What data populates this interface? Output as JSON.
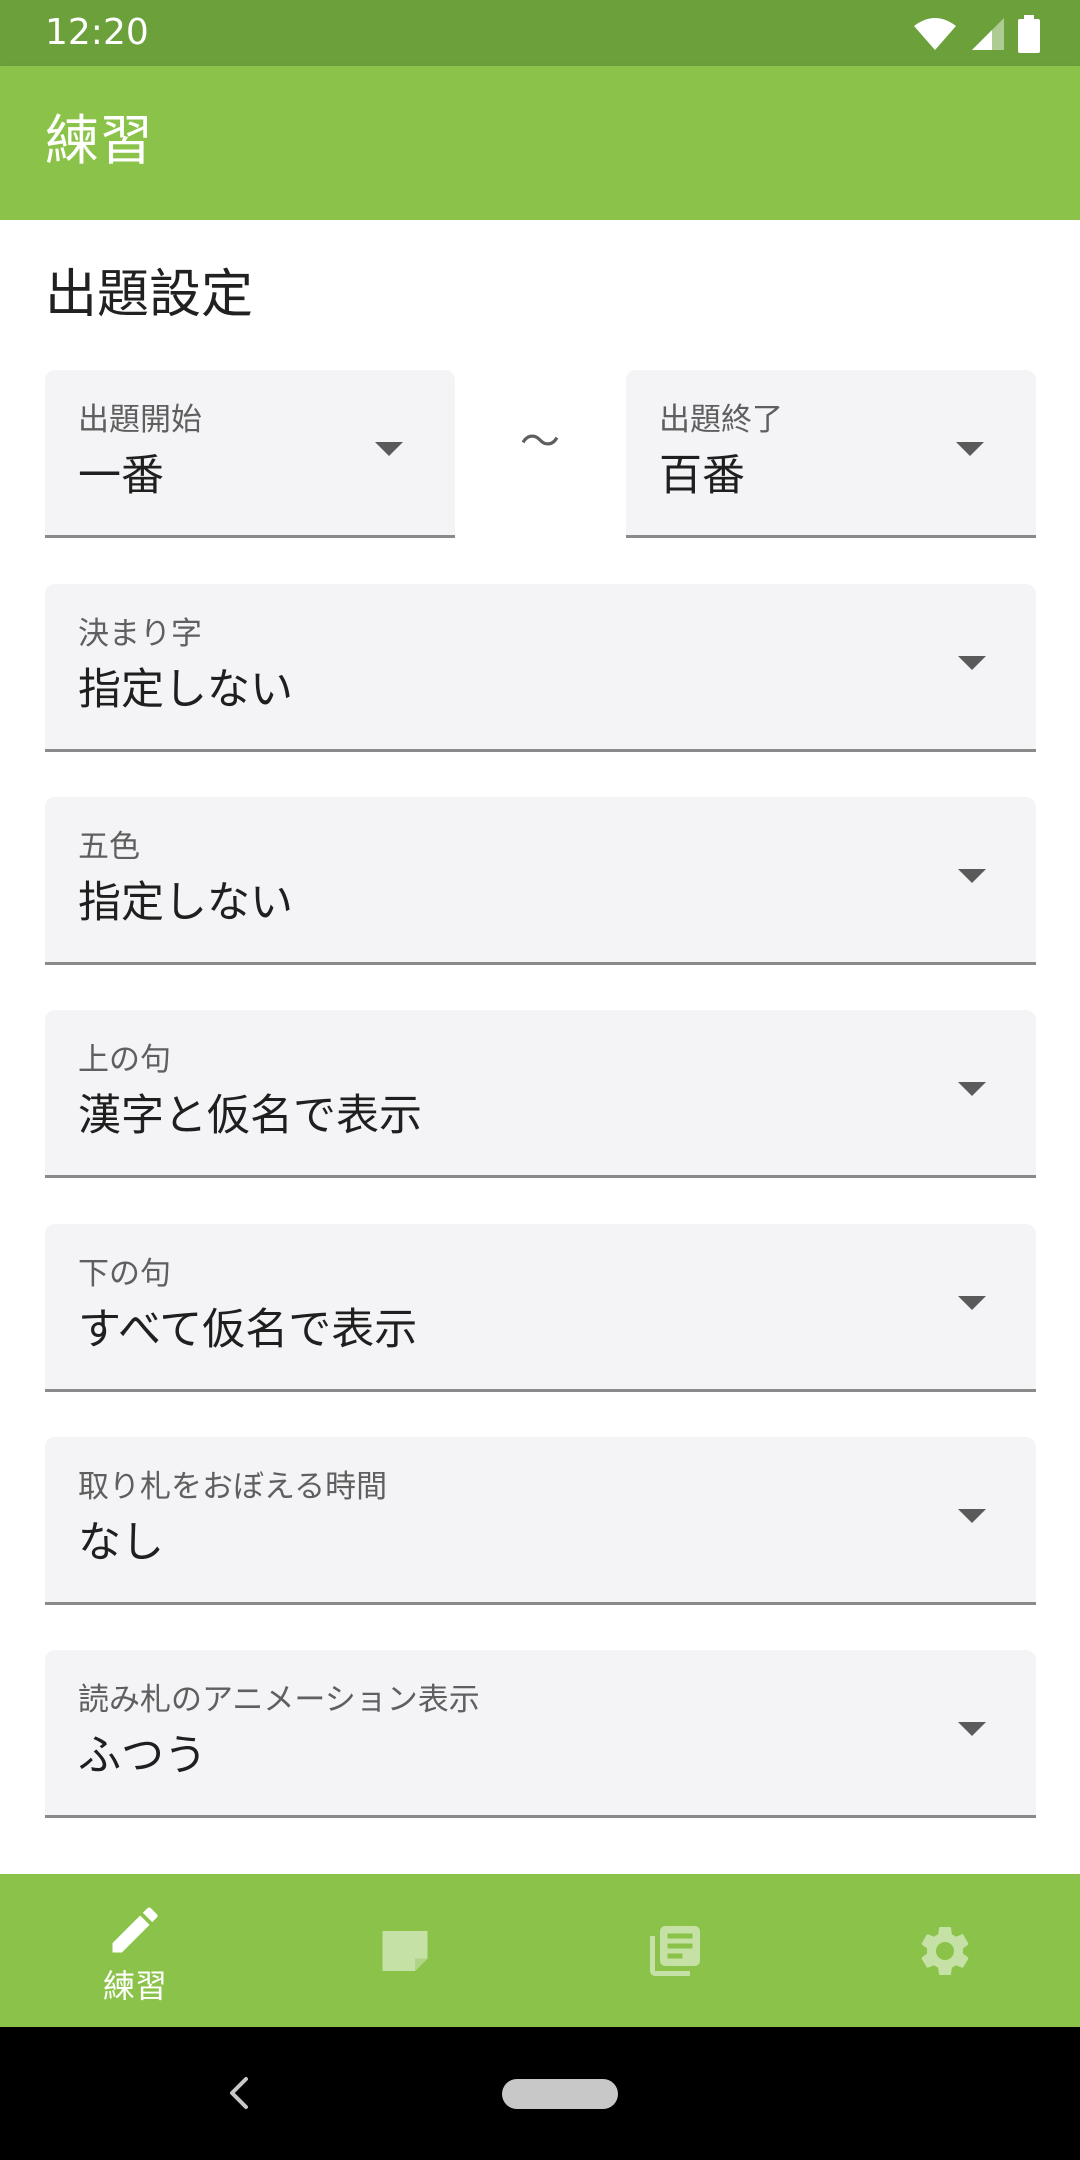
{
  "status_bar": {
    "time": "12:20"
  },
  "app_bar": {
    "title": "練習"
  },
  "section": {
    "title": "出題設定"
  },
  "range": {
    "start": {
      "label": "出題開始",
      "value": "一番"
    },
    "separator": "〜",
    "end": {
      "label": "出題終了",
      "value": "百番"
    }
  },
  "fields": [
    {
      "label": "決まり字",
      "value": "指定しない"
    },
    {
      "label": "五色",
      "value": "指定しない"
    },
    {
      "label": "上の句",
      "value": "漢字と仮名で表示"
    },
    {
      "label": "下の句",
      "value": "すべて仮名で表示"
    },
    {
      "label": "取り札をおぼえる時間",
      "value": "なし"
    },
    {
      "label": "読み札のアニメーション表示",
      "value": "ふつう"
    }
  ],
  "bottom_nav": {
    "items": [
      {
        "label": "練習",
        "icon": "pencil-icon",
        "active": true
      },
      {
        "label": "",
        "icon": "card-icon",
        "active": false
      },
      {
        "label": "",
        "icon": "library-icon",
        "active": false
      },
      {
        "label": "",
        "icon": "gear-icon",
        "active": false
      }
    ]
  },
  "colors": {
    "status_bar": "#6ba03b",
    "primary": "#8bc34a",
    "field_background": "#f4f3f6",
    "inactive_icon": "#c5e1a5"
  }
}
